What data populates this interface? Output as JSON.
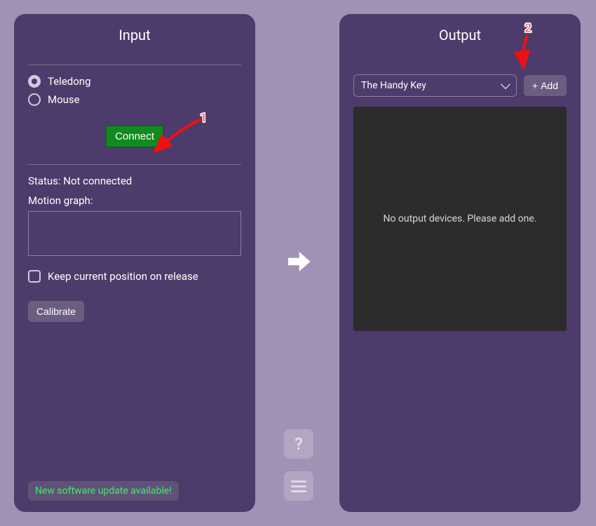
{
  "input_panel": {
    "title": "Input",
    "options": {
      "teledong": "Teledong",
      "mouse": "Mouse"
    },
    "connect_label": "Connect",
    "status_label": "Status: Not connected",
    "motion_label": "Motion graph:",
    "keep_position_label": "Keep current position on release",
    "calibrate_label": "Calibrate",
    "update_banner": "New software update available!"
  },
  "output_panel": {
    "title": "Output",
    "select_value": "The Handy Key",
    "add_label": "Add",
    "empty_message": "No output devices. Please add one."
  },
  "help_label": "?",
  "annotations": {
    "a1": "1",
    "a2": "2"
  },
  "colors": {
    "bg": "#a191b4",
    "panel": "#4d3b6b",
    "connect": "#108b1f",
    "output_box": "#2c2c2c",
    "anno": "#e11"
  }
}
